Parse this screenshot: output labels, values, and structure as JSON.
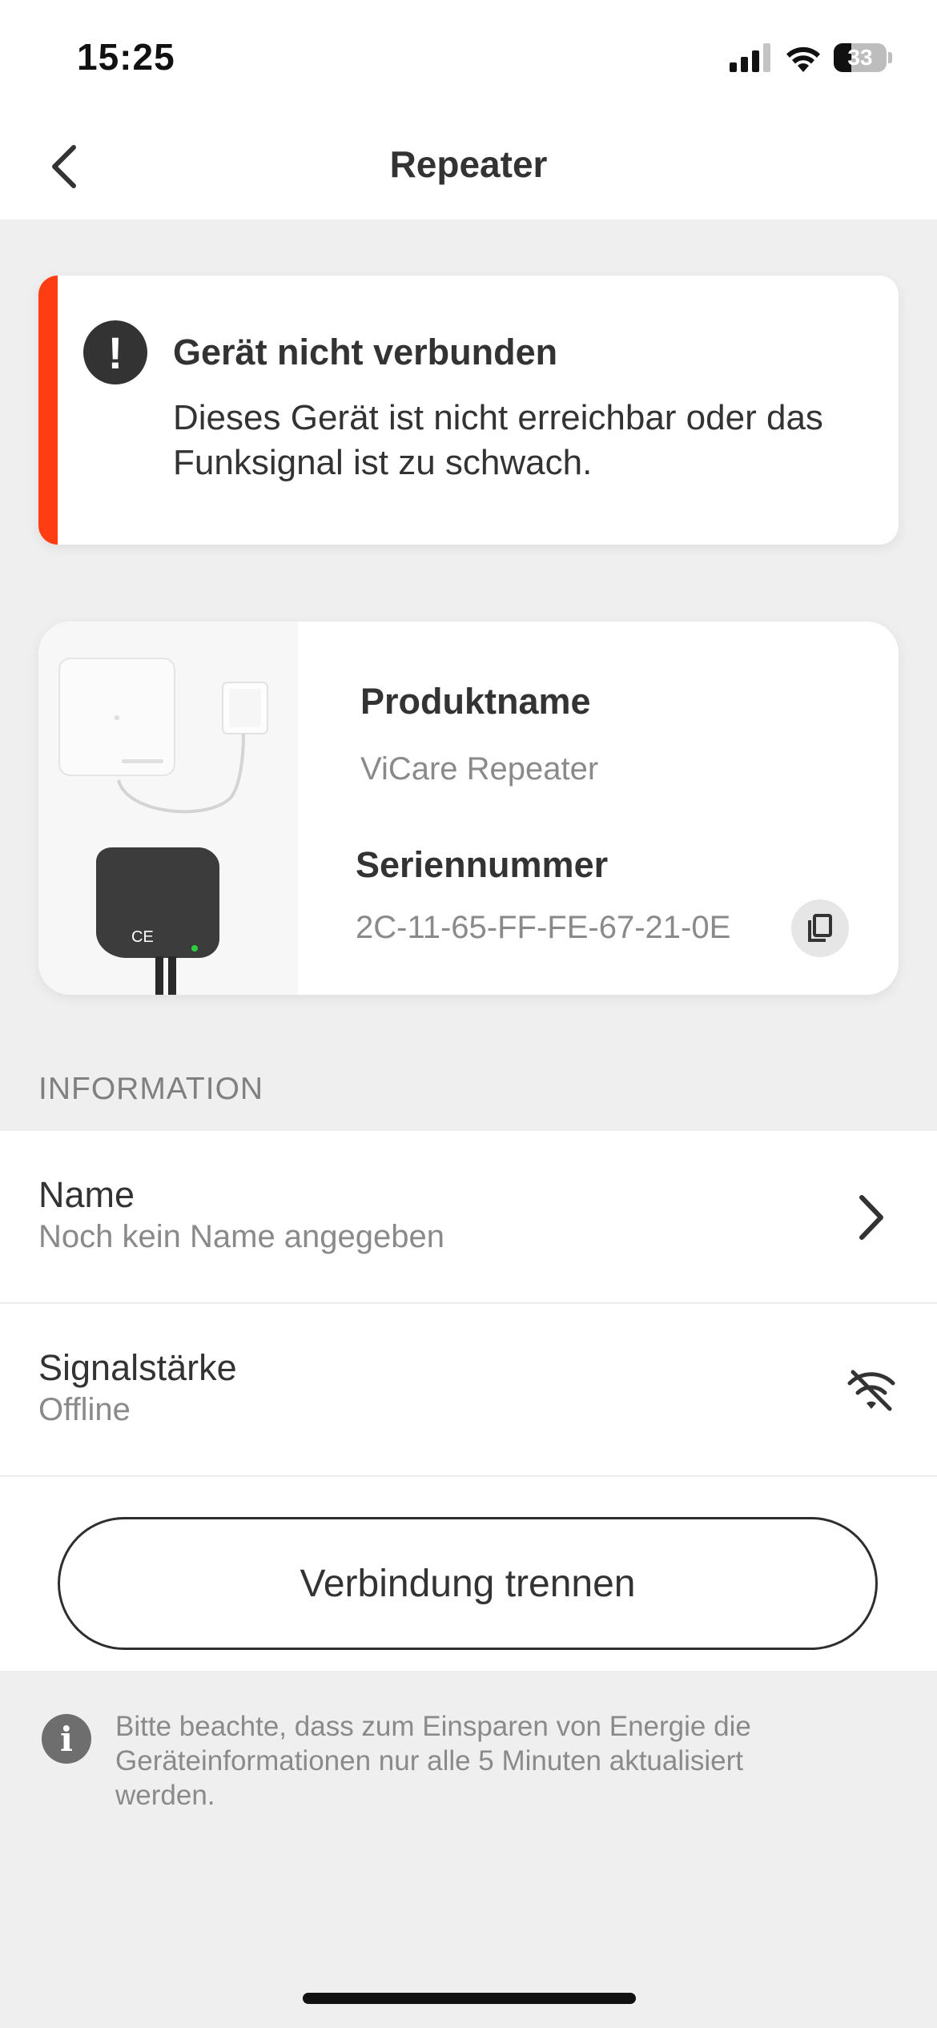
{
  "status_bar": {
    "time": "15:25",
    "battery": "33",
    "battery_level": 0.33
  },
  "nav": {
    "title": "Repeater"
  },
  "alert": {
    "title": "Gerät nicht verbunden",
    "message": "Dieses Gerät ist nicht erreichbar oder das Funksignal ist zu schwach.",
    "accent_color": "#ff3d12"
  },
  "product": {
    "name_label": "Produktname",
    "name_value": "ViCare Repeater",
    "serial_label": "Seriennummer",
    "serial_value": "2C-11-65-FF-FE-67-21-0E"
  },
  "information": {
    "header": "INFORMATION",
    "items": [
      {
        "title": "Name",
        "subtitle": "Noch kein Name angegeben",
        "icon": "chevron-right-icon"
      },
      {
        "title": "Signalstärke",
        "subtitle": "Offline",
        "icon": "wifi-off-icon"
      }
    ],
    "disconnect_label": "Verbindung trennen"
  },
  "footer_note": "Bitte beachte, dass zum Einsparen von Energie die Geräteinformationen nur alle 5 Minuten aktualisiert werden."
}
